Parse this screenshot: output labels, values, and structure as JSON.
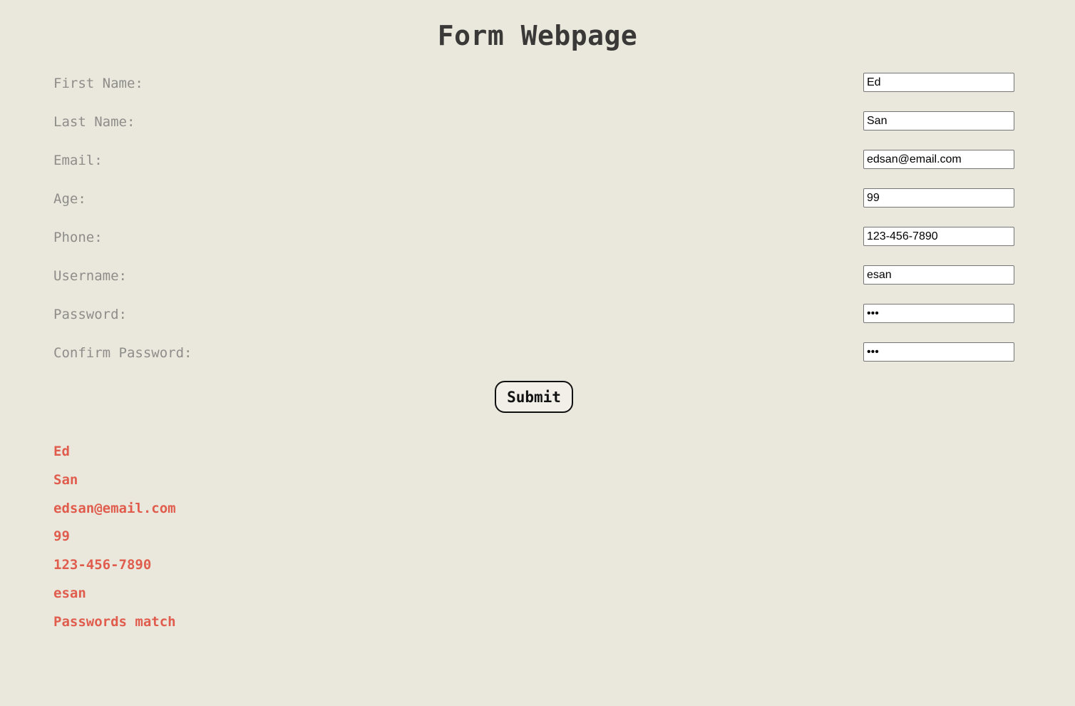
{
  "page": {
    "title": "Form Webpage",
    "colors": {
      "background": "#eae7dc",
      "title": "#3a3937",
      "label": "#8e8d8a",
      "output": "#e05d4e"
    }
  },
  "form": {
    "fields": [
      {
        "label": "First Name:",
        "value": "Ed",
        "type": "text"
      },
      {
        "label": "Last Name:",
        "value": "San",
        "type": "text"
      },
      {
        "label": "Email:",
        "value": "edsan@email.com",
        "type": "email"
      },
      {
        "label": "Age:",
        "value": "99",
        "type": "number"
      },
      {
        "label": "Phone:",
        "value": "123-456-7890",
        "type": "tel"
      },
      {
        "label": "Username:",
        "value": "esan",
        "type": "text"
      },
      {
        "label": "Password:",
        "value": "•••",
        "type": "password"
      },
      {
        "label": "Confirm Password:",
        "value": "•••",
        "type": "password"
      }
    ],
    "submit_label": "Submit"
  },
  "output": {
    "lines": [
      "Ed",
      "San",
      "edsan@email.com",
      "99",
      "123-456-7890",
      "esan",
      "Passwords match"
    ]
  }
}
